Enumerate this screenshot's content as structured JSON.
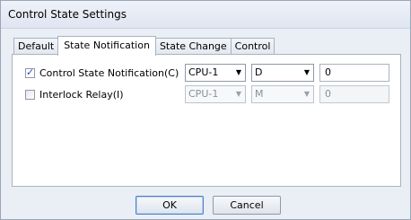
{
  "window": {
    "title": "Control State Settings"
  },
  "tabs": [
    {
      "label": "Default",
      "active": false
    },
    {
      "label": "State Notification",
      "active": true
    },
    {
      "label": "State Change",
      "active": false
    },
    {
      "label": "Control",
      "active": false
    }
  ],
  "rows": [
    {
      "checkbox_label": "Control State Notification(C)",
      "checked": true,
      "cpu_select": "CPU-1",
      "device_select": "D",
      "value": "0",
      "enabled": true
    },
    {
      "checkbox_label": "Interlock Relay(I)",
      "checked": false,
      "cpu_select": "CPU-1",
      "device_select": "M",
      "value": "0",
      "enabled": false
    }
  ],
  "buttons": {
    "ok": "OK",
    "cancel": "Cancel"
  },
  "icons": {
    "dropdown": "chevron-down-icon",
    "checkmark": "checkmark-icon"
  }
}
